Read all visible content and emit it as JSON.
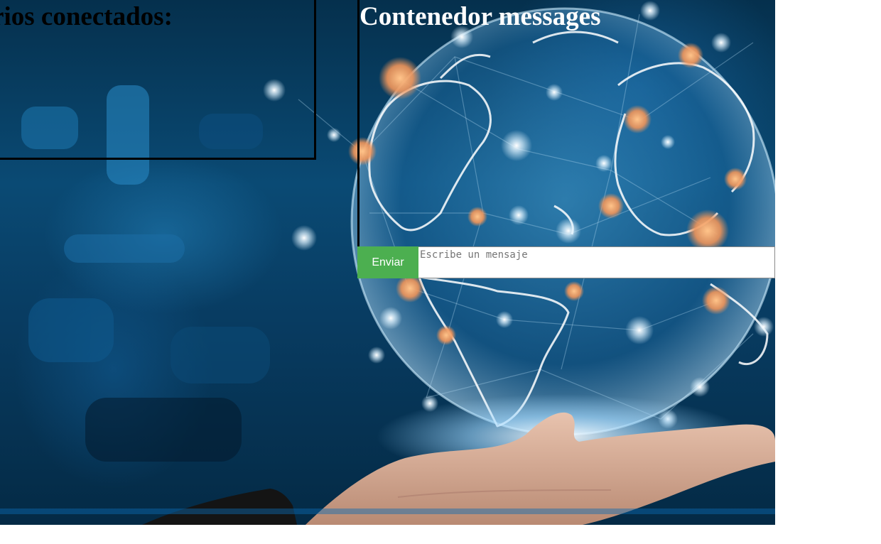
{
  "users": {
    "title": "uarios conectados:"
  },
  "messages": {
    "title": "Contenedor messages"
  },
  "form": {
    "send_label": "Enviar",
    "input_placeholder": "Escribe un mensaje",
    "input_value": ""
  },
  "colors": {
    "send_button": "#4caf50",
    "panel_border": "#000000",
    "background_dark": "#05304d"
  },
  "background": {
    "description_icon": "globe-in-hand-image"
  }
}
